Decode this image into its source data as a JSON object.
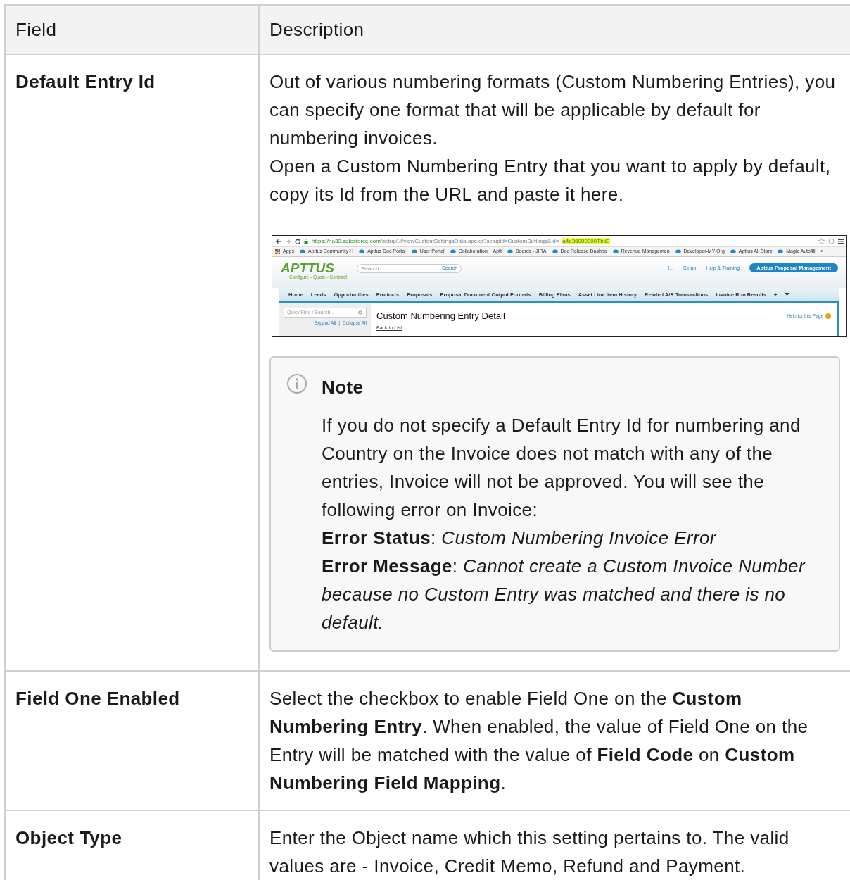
{
  "table": {
    "columns": [
      "Field",
      "Description"
    ],
    "rows": [
      {
        "field": "Default Entry Id",
        "paragraphs": [
          "Out of various numbering formats (Custom Numbering Entries), you can specify one format that will be applicable by default for numbering invoices.",
          "Open a Custom Numbering Entry that you want to apply by default, copy its Id from the URL and paste it here."
        ],
        "screenshot": {
          "url_host": "https://na30.salesforce.com",
          "url_path": "/setup/ui/viewCustomSettingsData.apexp?setupid=CustomSettings&id=",
          "url_highlight": "a4e36000000Tbd3",
          "bookmarks": [
            "Apps",
            "Apttus Community H",
            "Apttus Doc Portal",
            "User Portal",
            "Collaboration ~ Aptt",
            "Boards - JIRA",
            "Doc Release Dashbo",
            "Revenue Managemen",
            "Developer-MY Org",
            "Apttus All Stars",
            "Magic Autofill"
          ],
          "bookmarks_more": "»",
          "logo": "APTTUS",
          "tagline": "Configure - Quote - Contract",
          "search_placeholder": "Search...",
          "search_button": "Search",
          "header_links": [
            "I...",
            "Setup",
            "Help & Training"
          ],
          "app_menu": "Apttus Proposal Management",
          "tabs": [
            "Home",
            "Leads",
            "Opportunities",
            "Products",
            "Proposals",
            "Proposal Document Output Formats",
            "Billing Plans",
            "Asset Line Item History",
            "Related A/R Transactions",
            "Invoice Run Results",
            "+"
          ],
          "quick_find_placeholder": "Quick Find / Search...",
          "expand_all": "Expand All",
          "link_separator": "|",
          "collapse_all": "Collapse All",
          "page_title": "Custom Numbering Entry Detail",
          "help_link": "Help for this Page",
          "back_link": "Back to List"
        },
        "note": {
          "title": "Note",
          "lines": [
            "If you do not specify a Default Entry Id for numbering and Country on the Invoice does not match with any of the entries, Invoice will not be approved. You will see the following error on Invoice:",
            "**Error Status**: *Custom Numbering Invoice Error*",
            "**Error Message**: *Cannot create a Custom Invoice Number because no Custom Entry was matched and there is no default.*"
          ]
        }
      },
      {
        "field": "Field One Enabled",
        "paragraphs": [
          "Select the checkbox to enable Field One on the **Custom Numbering Entry**. When enabled, the value of Field One on the Entry will be matched with the value of **Field Code** on **Custom Numbering Field Mapping**."
        ]
      },
      {
        "field": "Object Type",
        "paragraphs": [
          "Enter the Object name which this setting pertains to. The valid values are - Invoice, Credit Memo, Refund and Payment."
        ]
      }
    ]
  }
}
